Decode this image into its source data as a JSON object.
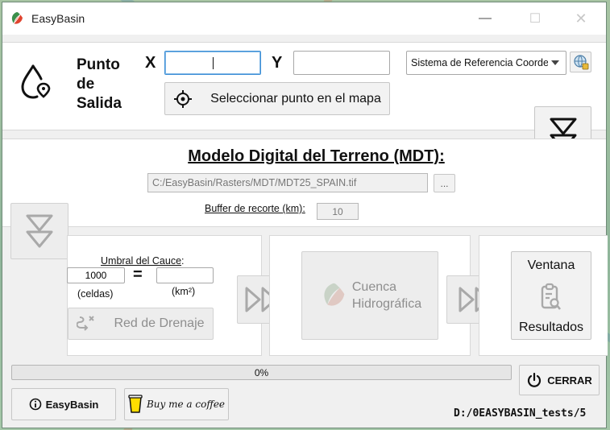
{
  "window": {
    "title": "EasyBasin",
    "minimize_glyph": "—",
    "maximize_glyph": "☐",
    "close_glyph": "✕"
  },
  "outlet": {
    "label_line1": "Punto",
    "label_line2": "de",
    "label_line3": "Salida",
    "x_label": "X",
    "y_label": "Y",
    "x_value": "",
    "y_value": "",
    "crs_select": "Sistema de Referencia Coordenadas",
    "select_point_button": "Seleccionar punto en el mapa"
  },
  "mdt": {
    "title": "Modelo Digital del Terreno (MDT):",
    "path": "C:/EasyBasin/Rasters/MDT/MDT25_SPAIN.tif",
    "browse_button": "...",
    "buffer_label": "Buffer de recorte (km):",
    "buffer_value": "10"
  },
  "drainage": {
    "umbral_label": "Umbral del Cauce",
    "umbral_colon": ":",
    "cells_value": "1000",
    "equals": "=",
    "km2_value": "",
    "cells_unit": "(celdas)",
    "km2_unit": "(km²)",
    "red_button": "Red de Drenaje"
  },
  "basin": {
    "button_line1": "Cuenca",
    "button_line2": "Hidrográfica"
  },
  "results": {
    "line1": "Ventana",
    "line2": "Resultados"
  },
  "progress": {
    "value": 0,
    "label": "0%"
  },
  "footer": {
    "close_button": "CERRAR",
    "about_button": "EasyBasin",
    "coffee_button": "Buy me a coffee",
    "path_status": "D:/0EASYBASIN_tests/5"
  },
  "colors": {
    "accent_focus": "#3c8fd6",
    "icon_disabled": "#a9a9a9",
    "text": "#111111"
  },
  "icons": [
    "easybasin-logo-icon",
    "drop-location-icon",
    "crosshair-icon",
    "globe-settings-icon",
    "chevron-double-down-icon",
    "double-arrow-right-icon",
    "drainage-icon",
    "clipboard-search-icon",
    "power-icon",
    "info-icon",
    "coffee-cup-icon"
  ]
}
